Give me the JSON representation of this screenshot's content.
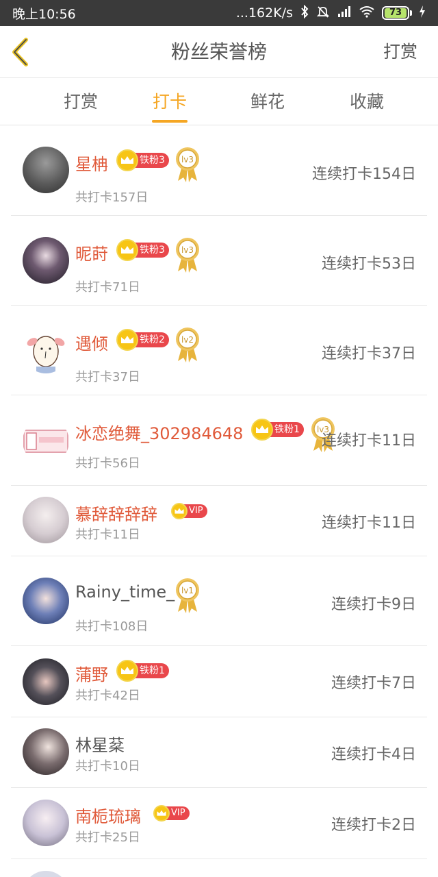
{
  "status_bar": {
    "time": "晚上10:56",
    "network_speed": "...162K/s",
    "battery": "73"
  },
  "header": {
    "title": "粉丝荣誉榜",
    "action": "打赏"
  },
  "tabs": [
    {
      "label": "打赏",
      "active": false
    },
    {
      "label": "打卡",
      "active": true
    },
    {
      "label": "鲜花",
      "active": false
    },
    {
      "label": "收藏",
      "active": false
    }
  ],
  "fans": [
    {
      "name": "星柟",
      "badge": "铁粉3",
      "level": "lv3",
      "total": "共打卡157日",
      "streak": "连续打卡154日"
    },
    {
      "name": "昵莳",
      "badge": "铁粉3",
      "level": "lv3",
      "total": "共打卡71日",
      "streak": "连续打卡53日"
    },
    {
      "name": "遇倾",
      "badge": "铁粉2",
      "level": "lv2",
      "total": "共打卡37日",
      "streak": "连续打卡37日"
    },
    {
      "name": "冰恋绝舞_302984648",
      "badge": "铁粉1",
      "level": "lv3",
      "total": "共打卡56日",
      "streak": "连续打卡11日"
    },
    {
      "name": "慕辞辞辞辞",
      "vip": "VIP",
      "total": "共打卡11日",
      "streak": "连续打卡11日"
    },
    {
      "name": "Rainy_time_",
      "level": "lv1",
      "total": "共打卡108日",
      "streak": "连续打卡9日"
    },
    {
      "name": "蒲野",
      "badge": "铁粉1",
      "total": "共打卡42日",
      "streak": "连续打卡7日"
    },
    {
      "name": "林星棻",
      "total": "共打卡10日",
      "streak": "连续打卡4日"
    },
    {
      "name": "南栀琉璃",
      "vip": "VIP",
      "total": "共打卡25日",
      "streak": "连续打卡2日"
    }
  ],
  "colors": {
    "accent": "#f5a623",
    "name_highlight": "#e05a3a",
    "badge_red": "#e9474b",
    "crown_gold": "#f7c515"
  }
}
